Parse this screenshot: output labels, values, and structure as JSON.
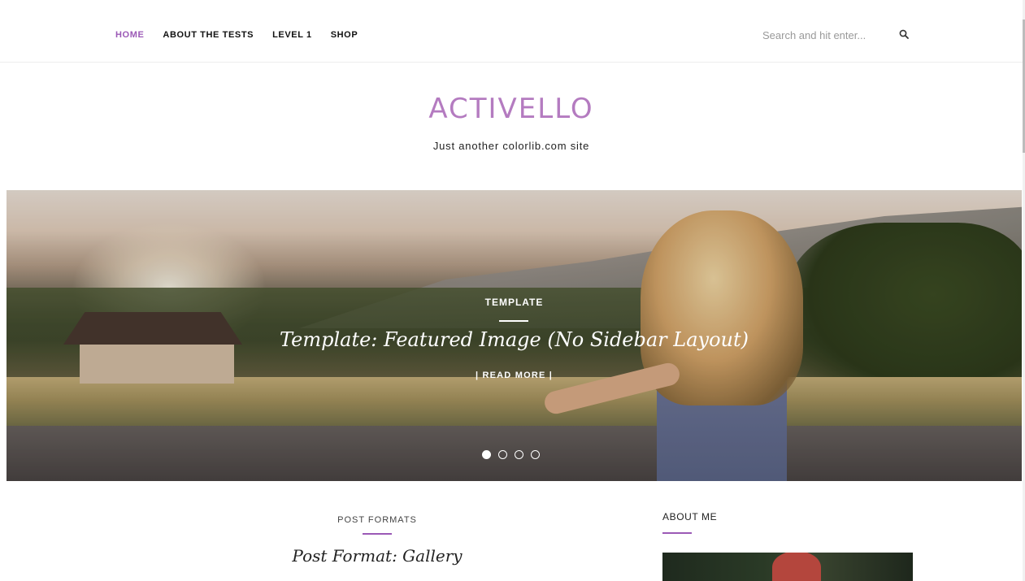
{
  "nav": {
    "items": [
      {
        "label": "HOME",
        "active": true
      },
      {
        "label": "ABOUT THE TESTS",
        "active": false
      },
      {
        "label": "LEVEL 1",
        "active": false
      },
      {
        "label": "SHOP",
        "active": false
      }
    ],
    "accent_color": "#9b59b6"
  },
  "search": {
    "placeholder": "Search and hit enter...",
    "value": "",
    "icon": "search-icon"
  },
  "site": {
    "title": "ACTIVELLO",
    "tagline": "Just another colorlib.com site",
    "title_color": "#b47bc0"
  },
  "slider": {
    "category": "TEMPLATE",
    "title": "Template: Featured Image (No Sidebar Layout)",
    "read_more": "| READ MORE |",
    "slide_count": 4,
    "active_slide": 1
  },
  "post": {
    "category": "POST FORMATS",
    "title": "Post Format: Gallery"
  },
  "sidebar": {
    "widget_title": "ABOUT ME"
  }
}
